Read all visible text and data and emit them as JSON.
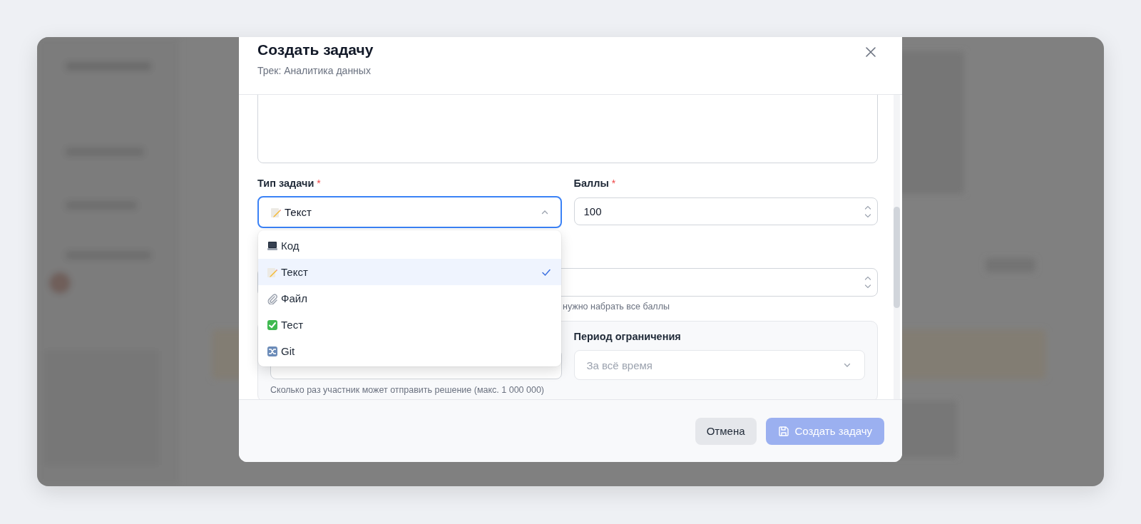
{
  "dialog": {
    "title": "Создать задачу",
    "subtitle": "Трек: Аналитика данных"
  },
  "task_type": {
    "label": "Тип задачи",
    "required_mark": "*",
    "value": "Текст",
    "expanded": true,
    "options": [
      {
        "label": "Код",
        "kind": "laptop",
        "selected": false
      },
      {
        "label": "Текст",
        "kind": "pencil",
        "selected": true
      },
      {
        "label": "Файл",
        "kind": "paperclip",
        "selected": false
      },
      {
        "label": "Тест",
        "kind": "checkbox",
        "selected": false
      },
      {
        "label": "Git",
        "kind": "shuffle",
        "selected": false
      }
    ]
  },
  "points": {
    "label": "Баллы",
    "required_mark": "*",
    "value": "100"
  },
  "threshold_hint": "нужно набрать все баллы",
  "limit_panel": {
    "period": {
      "label": "Период ограничения",
      "placeholder": "За всё время"
    },
    "hint": "Сколько раз участник может отправить решение (макс. 1 000 000)"
  },
  "buttons": [
    {
      "label": "Отмена",
      "kind": "secondary",
      "disabled": false
    },
    {
      "label": "Создать задачу",
      "kind": "primary",
      "disabled": true
    }
  ]
}
